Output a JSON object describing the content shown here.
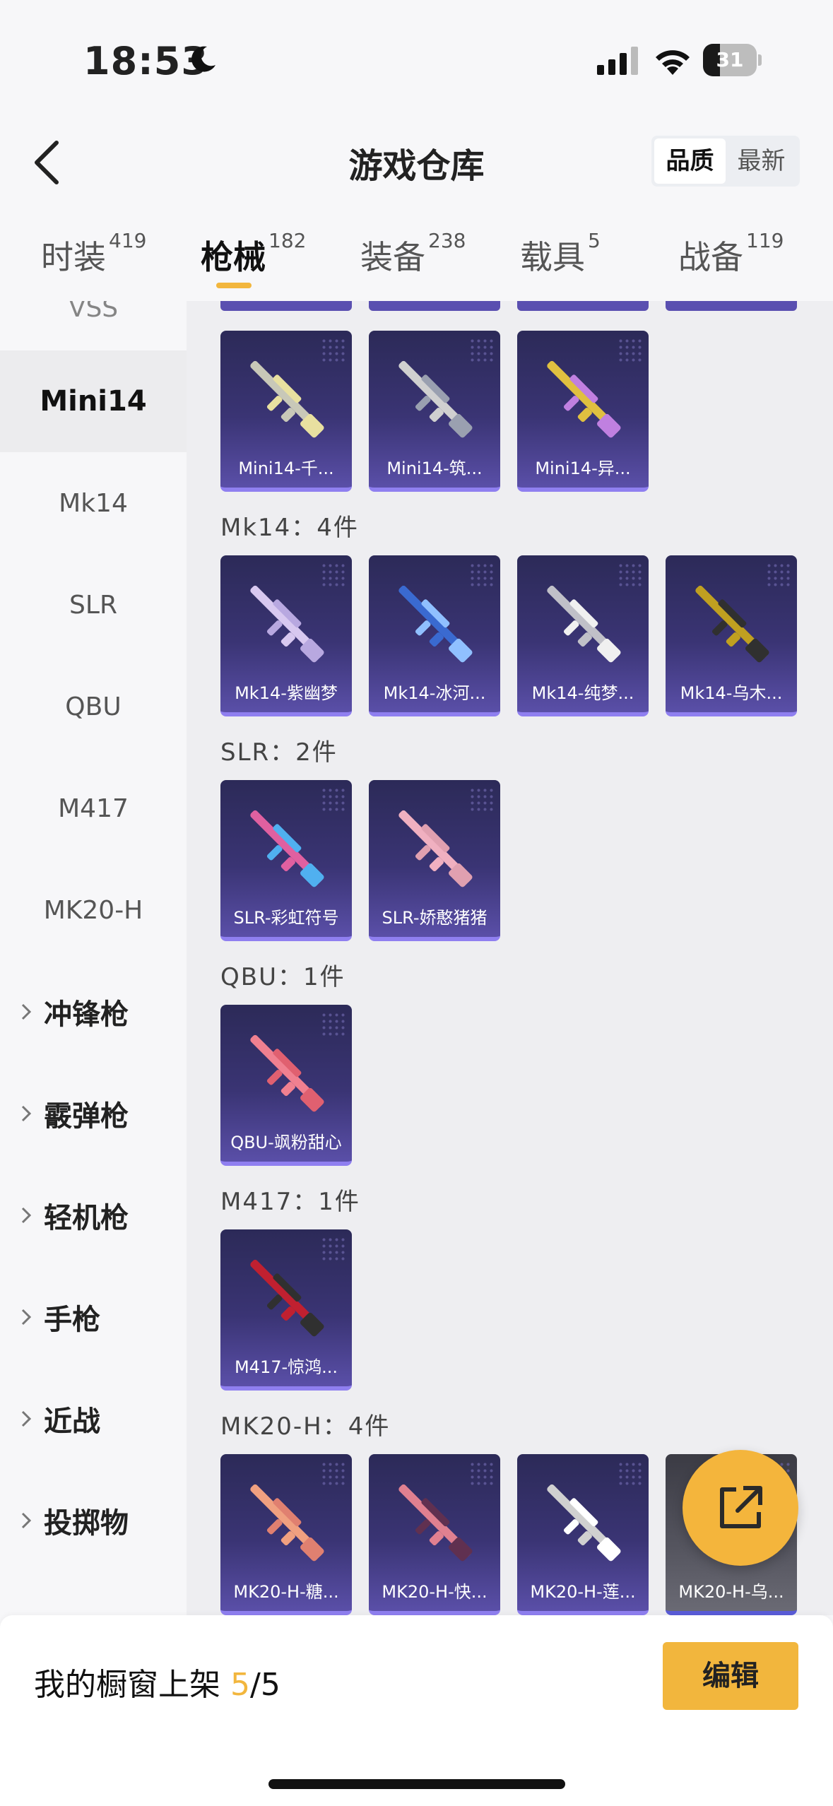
{
  "status_bar": {
    "time": "18:53",
    "battery": "31",
    "battery_level": 0.31
  },
  "header": {
    "title": "游戏仓库",
    "sort_options": [
      "品质",
      "最新"
    ],
    "sort_selected": "品质"
  },
  "tabs": [
    {
      "label": "时装",
      "count": "419"
    },
    {
      "label": "枪械",
      "count": "182"
    },
    {
      "label": "装备",
      "count": "238"
    },
    {
      "label": "载具",
      "count": "5"
    },
    {
      "label": "战备",
      "count": "119"
    }
  ],
  "sidebar": {
    "partial_item": "VSS",
    "items": [
      "Mini14",
      "Mk14",
      "SLR",
      "QBU",
      "M417",
      "MK20-H"
    ],
    "active": "Mini14",
    "categories": [
      "冲锋枪",
      "霰弹枪",
      "轻机枪",
      "手枪",
      "近战",
      "投掷物"
    ]
  },
  "groups": [
    {
      "label": "",
      "items": [
        "Mini14-千...",
        "Mini14-筑...",
        "Mini14-异..."
      ]
    },
    {
      "label": "Mk14：4件",
      "items": [
        "Mk14-紫幽梦",
        "Mk14-冰河...",
        "Mk14-纯梦...",
        "Mk14-乌木..."
      ]
    },
    {
      "label": "SLR：2件",
      "items": [
        "SLR-彩虹符号",
        "SLR-娇憨猪猪"
      ]
    },
    {
      "label": "QBU：1件",
      "items": [
        "QBU-飒粉甜心"
      ]
    },
    {
      "label": "M417：1件",
      "items": [
        "M417-惊鸿..."
      ]
    },
    {
      "label": "MK20-H：4件",
      "items": [
        "MK20-H-糖...",
        "MK20-H-快...",
        "MK20-H-莲...",
        "MK20-H-乌..."
      ]
    }
  ],
  "footer": {
    "label": "我的橱窗上架",
    "current": "5",
    "separator": "/",
    "total": "5",
    "edit_button": "编辑"
  },
  "colors": {
    "accent": "#f2b63d",
    "card_bg": "#3a3474",
    "card_border": "#8f7ff0"
  },
  "icons": [
    "moon-icon",
    "signal-icon",
    "wifi-icon",
    "battery-icon",
    "back-icon",
    "chevron-right-icon",
    "share-icon",
    "rifle-icon"
  ]
}
